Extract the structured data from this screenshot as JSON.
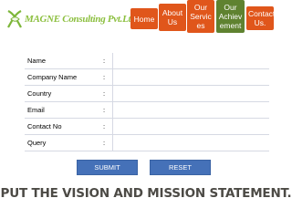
{
  "header": {
    "logo_text": "MAGNE Consulting Pvt.Ltd."
  },
  "nav": [
    {
      "label": "Home",
      "color": "#e0561b"
    },
    {
      "label": "About Us",
      "color": "#e0561b"
    },
    {
      "label": "Our Servic es",
      "color": "#e0561b"
    },
    {
      "label": "Our Achiev ement",
      "color": "#5f8230"
    },
    {
      "label": "Contact Us.",
      "color": "#e0561b"
    }
  ],
  "form": {
    "fields": [
      {
        "label": "Name",
        "sep": ":"
      },
      {
        "label": "Company Name",
        "sep": ":"
      },
      {
        "label": "Country",
        "sep": ":"
      },
      {
        "label": "Email",
        "sep": ":"
      },
      {
        "label": "Contact No",
        "sep": ":"
      },
      {
        "label": "Query",
        "sep": ":"
      }
    ],
    "submit_label": "SUBMIT",
    "reset_label": "RESET"
  },
  "statement": "PUT THE VISION AND MISSION STATEMENT.",
  "colors": {
    "accent_orange": "#e0561b",
    "accent_green": "#5f8230",
    "button_blue": "#4571b8",
    "logo_green": "#8cbf3f"
  }
}
